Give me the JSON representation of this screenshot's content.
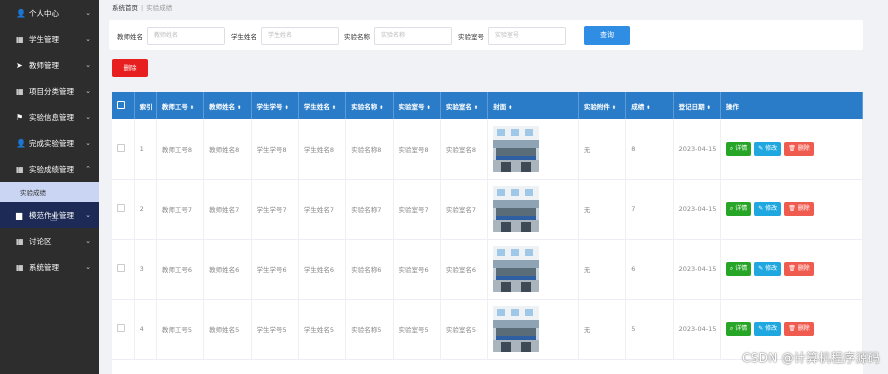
{
  "sidebar": {
    "items": [
      {
        "label": "个人中心",
        "icon": "user-icon",
        "glyph": "👤"
      },
      {
        "label": "学生管理",
        "icon": "grid-icon",
        "glyph": "▦"
      },
      {
        "label": "教师管理",
        "icon": "send-icon",
        "glyph": "➤"
      },
      {
        "label": "项目分类管理",
        "icon": "grid-icon",
        "glyph": "▦"
      },
      {
        "label": "实验信息管理",
        "icon": "flag-icon",
        "glyph": "⚑"
      },
      {
        "label": "完成实验管理",
        "icon": "user-icon",
        "glyph": "👤"
      },
      {
        "label": "实验成绩管理",
        "icon": "grid-icon",
        "glyph": "▦"
      }
    ],
    "sub_item": "实验成绩",
    "items_after": [
      {
        "label": "模范作业管理",
        "icon": "briefcase-icon",
        "glyph": "▆"
      },
      {
        "label": "讨论区",
        "icon": "grid-icon",
        "glyph": "▦"
      },
      {
        "label": "系统管理",
        "icon": "grid-icon",
        "glyph": "▦"
      }
    ]
  },
  "breadcrumb": {
    "home": "系统首页",
    "current": "实验成绩"
  },
  "search": {
    "fields": [
      {
        "label": "教师姓名",
        "placeholder": "教师姓名"
      },
      {
        "label": "学生姓名",
        "placeholder": "学生姓名"
      },
      {
        "label": "实验名称",
        "placeholder": "实验名称"
      },
      {
        "label": "实验室号",
        "placeholder": "实验室号"
      }
    ],
    "button": "查询"
  },
  "delete_label": "删除",
  "table": {
    "headers": [
      "索引",
      "教师工号",
      "教师姓名",
      "学生学号",
      "学生姓名",
      "实验名称",
      "实验室号",
      "实验室名",
      "封面",
      "实验附件",
      "成绩",
      "登记日期",
      "操作"
    ],
    "rows": [
      {
        "index": "1",
        "teacher_no": "教师工号8",
        "teacher_name": "教师姓名8",
        "student_no": "学生学号8",
        "student_name": "学生姓名8",
        "exp_name": "实验名称8",
        "lab_no": "实验室号8",
        "lab_name": "实验室名8",
        "attachment": "无",
        "score": "8",
        "date": "2023-04-15"
      },
      {
        "index": "2",
        "teacher_no": "教师工号7",
        "teacher_name": "教师姓名7",
        "student_no": "学生学号7",
        "student_name": "学生姓名7",
        "exp_name": "实验名称7",
        "lab_no": "实验室号7",
        "lab_name": "实验室名7",
        "attachment": "无",
        "score": "7",
        "date": "2023-04-15"
      },
      {
        "index": "3",
        "teacher_no": "教师工号6",
        "teacher_name": "教师姓名6",
        "student_no": "学生学号6",
        "student_name": "学生姓名6",
        "exp_name": "实验名称6",
        "lab_no": "实验室号6",
        "lab_name": "实验室名6",
        "attachment": "无",
        "score": "6",
        "date": "2023-04-15"
      },
      {
        "index": "4",
        "teacher_no": "教师工号5",
        "teacher_name": "教师姓名5",
        "student_no": "学生学号5",
        "student_name": "学生姓名5",
        "exp_name": "实验名称5",
        "lab_no": "实验室号5",
        "lab_name": "实验室名5",
        "attachment": "无",
        "score": "5",
        "date": "2023-04-15"
      }
    ],
    "ops": {
      "detail": "详情",
      "edit": "修改",
      "delete": "删除"
    }
  },
  "watermark": "CSDN @计算机程序源码",
  "colors": {
    "sidebar_bg": "#2d2d2d",
    "header_blue": "#2a7cc8",
    "search_btn": "#2f8de4",
    "delete_red": "#e81f1f"
  }
}
